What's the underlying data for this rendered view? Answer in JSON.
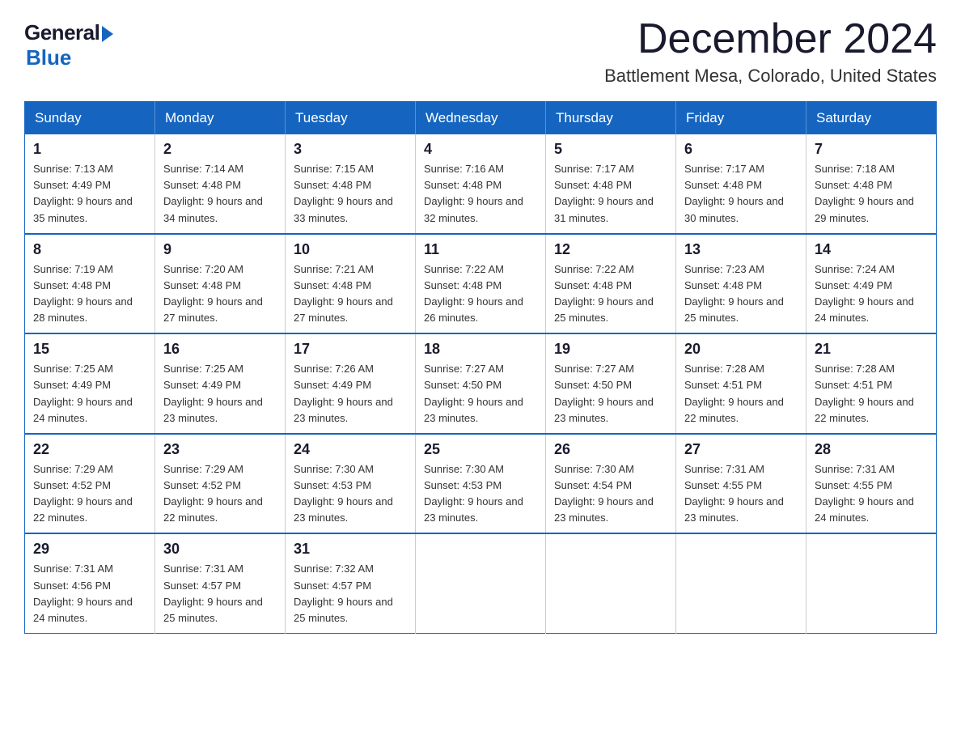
{
  "logo": {
    "general": "General",
    "blue": "Blue"
  },
  "title": {
    "month": "December 2024",
    "location": "Battlement Mesa, Colorado, United States"
  },
  "weekdays": [
    "Sunday",
    "Monday",
    "Tuesday",
    "Wednesday",
    "Thursday",
    "Friday",
    "Saturday"
  ],
  "weeks": [
    [
      {
        "day": "1",
        "sunrise": "7:13 AM",
        "sunset": "4:49 PM",
        "daylight": "9 hours and 35 minutes."
      },
      {
        "day": "2",
        "sunrise": "7:14 AM",
        "sunset": "4:48 PM",
        "daylight": "9 hours and 34 minutes."
      },
      {
        "day": "3",
        "sunrise": "7:15 AM",
        "sunset": "4:48 PM",
        "daylight": "9 hours and 33 minutes."
      },
      {
        "day": "4",
        "sunrise": "7:16 AM",
        "sunset": "4:48 PM",
        "daylight": "9 hours and 32 minutes."
      },
      {
        "day": "5",
        "sunrise": "7:17 AM",
        "sunset": "4:48 PM",
        "daylight": "9 hours and 31 minutes."
      },
      {
        "day": "6",
        "sunrise": "7:17 AM",
        "sunset": "4:48 PM",
        "daylight": "9 hours and 30 minutes."
      },
      {
        "day": "7",
        "sunrise": "7:18 AM",
        "sunset": "4:48 PM",
        "daylight": "9 hours and 29 minutes."
      }
    ],
    [
      {
        "day": "8",
        "sunrise": "7:19 AM",
        "sunset": "4:48 PM",
        "daylight": "9 hours and 28 minutes."
      },
      {
        "day": "9",
        "sunrise": "7:20 AM",
        "sunset": "4:48 PM",
        "daylight": "9 hours and 27 minutes."
      },
      {
        "day": "10",
        "sunrise": "7:21 AM",
        "sunset": "4:48 PM",
        "daylight": "9 hours and 27 minutes."
      },
      {
        "day": "11",
        "sunrise": "7:22 AM",
        "sunset": "4:48 PM",
        "daylight": "9 hours and 26 minutes."
      },
      {
        "day": "12",
        "sunrise": "7:22 AM",
        "sunset": "4:48 PM",
        "daylight": "9 hours and 25 minutes."
      },
      {
        "day": "13",
        "sunrise": "7:23 AM",
        "sunset": "4:48 PM",
        "daylight": "9 hours and 25 minutes."
      },
      {
        "day": "14",
        "sunrise": "7:24 AM",
        "sunset": "4:49 PM",
        "daylight": "9 hours and 24 minutes."
      }
    ],
    [
      {
        "day": "15",
        "sunrise": "7:25 AM",
        "sunset": "4:49 PM",
        "daylight": "9 hours and 24 minutes."
      },
      {
        "day": "16",
        "sunrise": "7:25 AM",
        "sunset": "4:49 PM",
        "daylight": "9 hours and 23 minutes."
      },
      {
        "day": "17",
        "sunrise": "7:26 AM",
        "sunset": "4:49 PM",
        "daylight": "9 hours and 23 minutes."
      },
      {
        "day": "18",
        "sunrise": "7:27 AM",
        "sunset": "4:50 PM",
        "daylight": "9 hours and 23 minutes."
      },
      {
        "day": "19",
        "sunrise": "7:27 AM",
        "sunset": "4:50 PM",
        "daylight": "9 hours and 23 minutes."
      },
      {
        "day": "20",
        "sunrise": "7:28 AM",
        "sunset": "4:51 PM",
        "daylight": "9 hours and 22 minutes."
      },
      {
        "day": "21",
        "sunrise": "7:28 AM",
        "sunset": "4:51 PM",
        "daylight": "9 hours and 22 minutes."
      }
    ],
    [
      {
        "day": "22",
        "sunrise": "7:29 AM",
        "sunset": "4:52 PM",
        "daylight": "9 hours and 22 minutes."
      },
      {
        "day": "23",
        "sunrise": "7:29 AM",
        "sunset": "4:52 PM",
        "daylight": "9 hours and 22 minutes."
      },
      {
        "day": "24",
        "sunrise": "7:30 AM",
        "sunset": "4:53 PM",
        "daylight": "9 hours and 23 minutes."
      },
      {
        "day": "25",
        "sunrise": "7:30 AM",
        "sunset": "4:53 PM",
        "daylight": "9 hours and 23 minutes."
      },
      {
        "day": "26",
        "sunrise": "7:30 AM",
        "sunset": "4:54 PM",
        "daylight": "9 hours and 23 minutes."
      },
      {
        "day": "27",
        "sunrise": "7:31 AM",
        "sunset": "4:55 PM",
        "daylight": "9 hours and 23 minutes."
      },
      {
        "day": "28",
        "sunrise": "7:31 AM",
        "sunset": "4:55 PM",
        "daylight": "9 hours and 24 minutes."
      }
    ],
    [
      {
        "day": "29",
        "sunrise": "7:31 AM",
        "sunset": "4:56 PM",
        "daylight": "9 hours and 24 minutes."
      },
      {
        "day": "30",
        "sunrise": "7:31 AM",
        "sunset": "4:57 PM",
        "daylight": "9 hours and 25 minutes."
      },
      {
        "day": "31",
        "sunrise": "7:32 AM",
        "sunset": "4:57 PM",
        "daylight": "9 hours and 25 minutes."
      },
      null,
      null,
      null,
      null
    ]
  ]
}
